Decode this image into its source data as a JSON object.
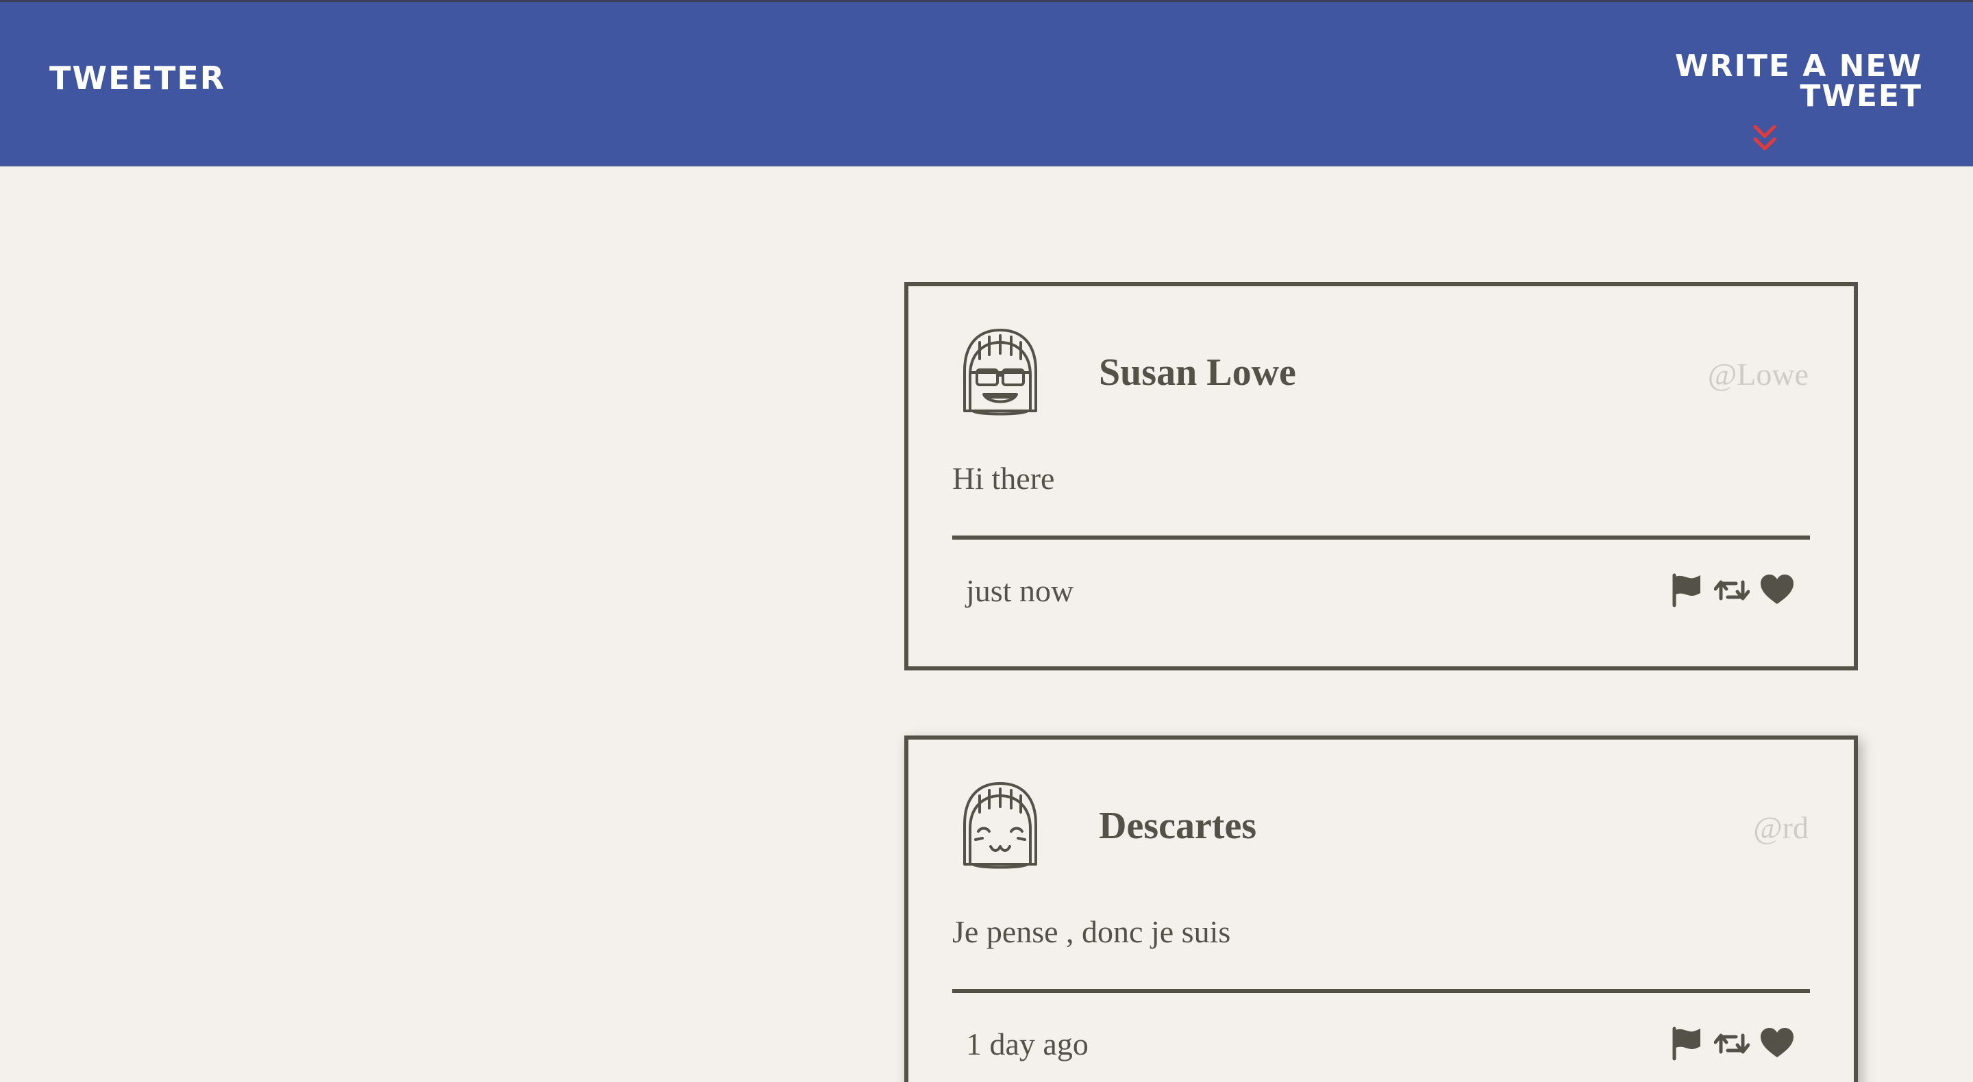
{
  "nav": {
    "brand": "TWEETER",
    "compose_label": "WRITE A NEW TWEET",
    "compose_icon": "double-chevron-down-icon",
    "accent": "#e33b3b",
    "background": "#4056a0"
  },
  "tweets": [
    {
      "author": "Susan Lowe",
      "handle": "@Lowe",
      "avatar": "sunglasses-avatar-icon",
      "text": "Hi there",
      "time": "just now",
      "actions": [
        "flag-icon",
        "retweet-icon",
        "heart-icon"
      ]
    },
    {
      "author": "Descartes",
      "handle": "@rd",
      "avatar": "smiling-avatar-icon",
      "text": "Je pense , donc je suis",
      "time": "1 day ago",
      "actions": [
        "flag-icon",
        "retweet-icon",
        "heart-icon"
      ]
    }
  ],
  "colors": {
    "page_background": "#f4f1ec",
    "text": "#545149",
    "handle": "#cfcbc5"
  }
}
